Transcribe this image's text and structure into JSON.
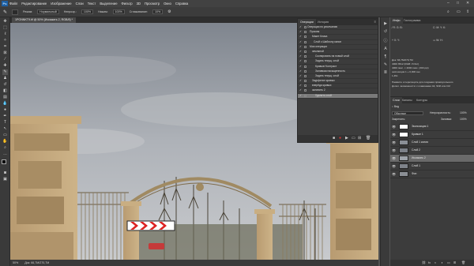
{
  "app": {
    "logo": "Ps",
    "menu": [
      "Файл",
      "Редактирование",
      "Изображение",
      "Слои",
      "Текст",
      "Выделение",
      "Фильтр",
      "3D",
      "Просмотр",
      "Окно",
      "Справка"
    ]
  },
  "options_bar": {
    "mode_label": "Режим:",
    "mode_value": "Нормальный",
    "opacity_label": "Непрозр.:",
    "opacity_value": "100%",
    "flow_label": "Нажим:",
    "flow_value": "100%",
    "smoothing_label": "Сглаживание:",
    "smoothing_value": "10%"
  },
  "document_tab": {
    "title": "1PONNKT9.tif @ 50% (Искажать 2, RGB/8) *"
  },
  "status_bar": {
    "zoom": "50%",
    "doc_info": "Док: 66,7M/270,7M"
  },
  "history_panel": {
    "tabs": [
      "Операции",
      "История"
    ],
    "rows": [
      {
        "label": "Операции по умолчанию",
        "indent": 12
      },
      {
        "label": "Пусковк",
        "indent": 15
      },
      {
        "label": "Макет Клика",
        "indent": 18
      },
      {
        "label": "Слой с Шаблону канон",
        "indent": 20
      },
      {
        "label": "Мои операции",
        "indent": 15
      },
      {
        "label": "земляной",
        "indent": 18
      },
      {
        "label": "Скопировать на новый слой",
        "indent": 22
      },
      {
        "label": "Задать текущ. слой",
        "indent": 22
      },
      {
        "label": "Кривые/ Контраст",
        "indent": 22
      },
      {
        "label": "Заливкаа насыщенность",
        "indent": 22
      },
      {
        "label": "Задать текущ. слой",
        "indent": 22
      },
      {
        "label": "Заурфелит кривых",
        "indent": 18
      },
      {
        "label": "вперёдя кривых",
        "indent": 18
      },
      {
        "label": "заливить 2",
        "indent": 18
      },
      {
        "label": "Удалить слой",
        "indent": 22
      }
    ]
  },
  "info_panel": {
    "tabs": [
      "Инфо",
      "Гистограмма"
    ],
    "lines": [
      "Док: 66,7M/270,7M",
      "4000 3512 (RGB / 8 бит)",
      "4000 пикс. × 4000 пикс. (300 ppi)",
      "экспозиция 1 + 0,000 сек.",
      "1,45с",
      "Нажмите и перетащите для создания прямоугольного",
      "Допол. возможности: с клавишами Alt, Shift или Ctrl"
    ]
  },
  "layers_panel": {
    "tabs": [
      "Слои",
      "Каналы",
      "Контуры"
    ],
    "kind_label": "Вид",
    "blend_mode": "Обычные",
    "opacity_label": "Непрозрачность:",
    "opacity_value": "100%",
    "lock_label": "Закрепить:",
    "fill_label": "Заливка:",
    "fill_value": "100%",
    "layers": [
      {
        "name": "Экспозиция 1",
        "thumb": "#ffffff",
        "selected": false
      },
      {
        "name": "Кривые 1",
        "thumb": "#ffffff",
        "selected": false
      },
      {
        "name": "Слой 1 копия",
        "thumb": "#8a8f96",
        "selected": false
      },
      {
        "name": "Слой 2",
        "thumb": "#7c8088",
        "selected": false
      },
      {
        "name": "Искажать 2",
        "thumb": "#9ea3aa",
        "selected": true
      },
      {
        "name": "Слой 1",
        "thumb": "#7f838a",
        "selected": false
      },
      {
        "name": "Фон",
        "thumb": "#8b8f95",
        "selected": false
      }
    ]
  }
}
